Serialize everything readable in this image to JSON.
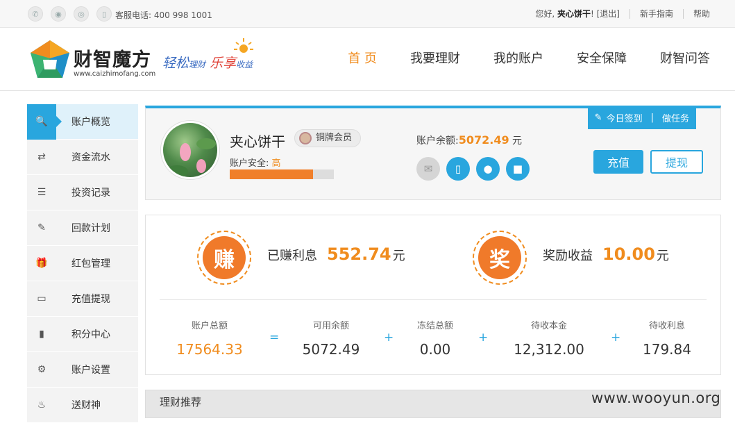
{
  "topbar": {
    "hotline": "客服电话: 400 998 1001",
    "greeting": "您好, ",
    "username": "夹心饼干",
    "logout": "! [退出]",
    "guide": "新手指南",
    "help": "帮助",
    "social_icons": [
      "wechat-icon",
      "qq-icon",
      "weibo-icon",
      "phone-icon"
    ]
  },
  "header": {
    "logo_text": "财智魔方",
    "logo_url": "www.caizhimofang.com",
    "slogan_a": "轻松",
    "slogan_b": "理财",
    "slogan_c": "乐享",
    "slogan_d": "收益",
    "nav": [
      "首 页",
      "我要理财",
      "我的账户",
      "安全保障",
      "财智问答"
    ]
  },
  "sidebar": {
    "items": [
      {
        "label": "账户概览",
        "icon": "search-icon",
        "glyph": "🔍"
      },
      {
        "label": "资金流水",
        "icon": "transfer-icon",
        "glyph": "⇄"
      },
      {
        "label": "投资记录",
        "icon": "list-icon",
        "glyph": "☰"
      },
      {
        "label": "回款计划",
        "icon": "edit-icon",
        "glyph": "✎"
      },
      {
        "label": "红包管理",
        "icon": "gift-icon",
        "glyph": "🎁"
      },
      {
        "label": "充值提现",
        "icon": "card-icon",
        "glyph": "▭"
      },
      {
        "label": "积分中心",
        "icon": "bookmark-icon",
        "glyph": "▮"
      },
      {
        "label": "账户设置",
        "icon": "gear-icon",
        "glyph": "⚙"
      },
      {
        "label": "送财神",
        "icon": "fire-icon",
        "glyph": "♨"
      }
    ]
  },
  "account": {
    "name": "夹心饼干",
    "member_level": "铜牌会员",
    "security_label": "账户安全: ",
    "security_level": "高",
    "security_progress": 0.8,
    "balance_label": "账户余额:",
    "balance_value": "5072.49",
    "balance_unit": " 元",
    "signin_label": "今日签到",
    "task_label": "做任务",
    "recharge_label": "充值",
    "withdraw_label": "提现",
    "verify_icons": [
      "mail-icon",
      "mobile-icon",
      "user-icon",
      "lock-icon"
    ]
  },
  "earnings": {
    "earned_char": "赚",
    "earned_label": "已赚利息",
    "earned_value": "552.74",
    "earned_unit": "元",
    "reward_char": "奖",
    "reward_label": "奖励收益",
    "reward_value": "10.00",
    "reward_unit": " 元"
  },
  "summary": {
    "items": [
      {
        "label": "账户总额",
        "value": "17564.33"
      },
      {
        "label": "可用余额",
        "value": "5072.49"
      },
      {
        "label": "冻结总额",
        "value": "0.00"
      },
      {
        "label": "待收本金",
        "value": "12,312.00"
      },
      {
        "label": "待收利息",
        "value": "179.84"
      }
    ],
    "ops": [
      "=",
      "+",
      "+",
      "+"
    ]
  },
  "recommend": {
    "title": "理财推荐"
  },
  "watermark": "www.wooyun.org",
  "colors": {
    "accent": "#29a6de",
    "orange": "#f08c1e"
  }
}
